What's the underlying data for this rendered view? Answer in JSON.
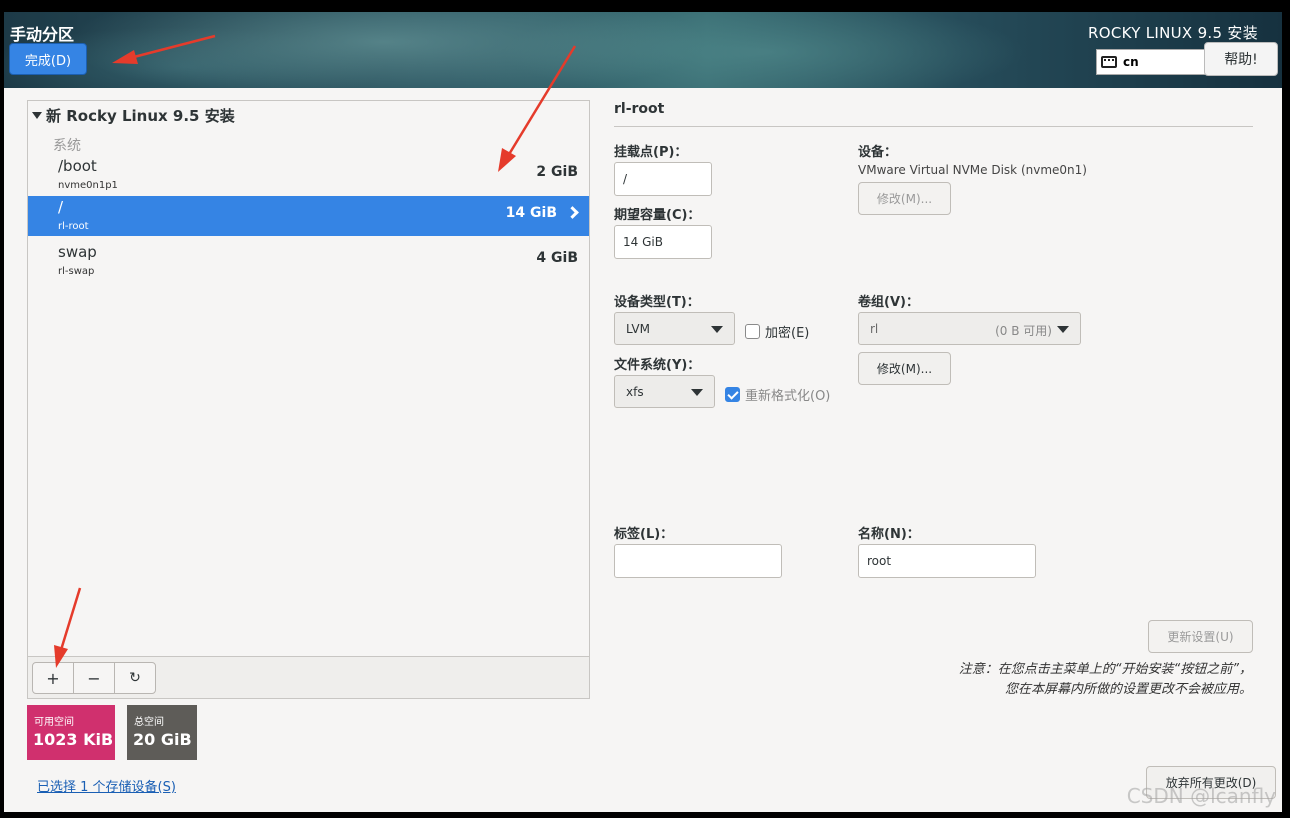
{
  "header": {
    "title": "手动分区",
    "done_label": "完成(D)",
    "product": "ROCKY LINUX 9.5 安装",
    "keyboard_layout": "cn",
    "help_label": "帮助!"
  },
  "tree": {
    "root_label": "新 Rocky Linux 9.5 安装",
    "group_label": "系统",
    "rows": [
      {
        "mount": "/boot",
        "device": "nvme0n1p1",
        "size": "2 GiB"
      },
      {
        "mount": "/",
        "device": "rl-root",
        "size": "14 GiB"
      },
      {
        "mount": "swap",
        "device": "rl-swap",
        "size": "4 GiB"
      }
    ],
    "toolbar": {
      "add": "+",
      "remove": "−",
      "refresh": "↻"
    }
  },
  "space": {
    "available_label": "可用空间",
    "available_value": "1023 KiB",
    "total_label": "总空间",
    "total_value": "20 GiB"
  },
  "storage_link": "已选择 1 个存储设备(S)",
  "detail": {
    "name": "rl-root",
    "mount_label": "挂载点(P)：",
    "mount_value": "/",
    "capacity_label": "期望容量(C)：",
    "capacity_value": "14 GiB",
    "device_label": "设备：",
    "device_value": "VMware Virtual NVMe Disk (nvme0n1)",
    "device_modify": "修改(M)...",
    "type_label": "设备类型(T)：",
    "type_value": "LVM",
    "encrypt_label": "加密(E)",
    "vg_label": "卷组(V)：",
    "vg_value": "rl",
    "vg_free": "(0 B 可用)",
    "vg_modify": "修改(M)...",
    "fs_label": "文件系统(Y)：",
    "fs_value": "xfs",
    "reformat_label": "重新格式化(O)",
    "tag_label": "标签(L)：",
    "tag_value": "",
    "name_label": "名称(N)：",
    "name_value": "root",
    "update_label": "更新设置(U)",
    "note_line1": "注意：在您点击主菜单上的“开始安装“按钮之前”，",
    "note_line2": "您在本屏幕内所做的设置更改不会被应用。",
    "discard_label": "放弃所有更改(D)"
  },
  "watermark": "CSDN @lcanfly",
  "colors": {
    "accent": "#3584e4",
    "available": "#d0306e",
    "total": "#5e5c58",
    "annotation": "#e53b2b"
  }
}
